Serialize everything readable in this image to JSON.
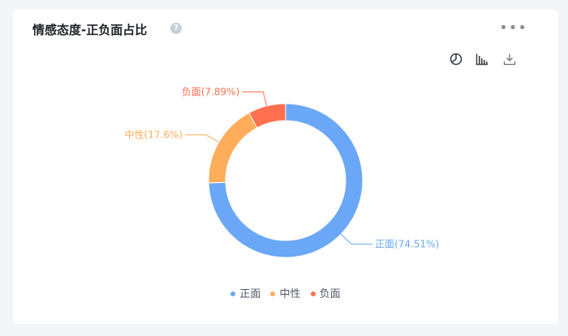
{
  "card": {
    "title": "情感态度-正负面占比",
    "help_icon": "question-circle-icon",
    "more_icon": "more-horizontal-icon",
    "tools": [
      {
        "name": "pie-chart-toggle-icon"
      },
      {
        "name": "bar-chart-toggle-icon"
      },
      {
        "name": "download-icon"
      }
    ]
  },
  "colors": {
    "positive": "#6aa7f7",
    "neutral": "#ffad5a",
    "negative": "#ff7050"
  },
  "chart_data": {
    "type": "pie",
    "donut": true,
    "series": [
      {
        "values": [
          {
            "category": "正面",
            "value": 74.51,
            "label": "正面(74.51%)"
          },
          {
            "category": "中性",
            "value": 17.6,
            "label": "中性(17.6%)"
          },
          {
            "category": "负面",
            "value": 7.89,
            "label": "负面(7.89%)"
          }
        ]
      }
    ],
    "legend": {
      "placement": "bottom",
      "entries": [
        "正面",
        "中性",
        "负面"
      ]
    }
  }
}
